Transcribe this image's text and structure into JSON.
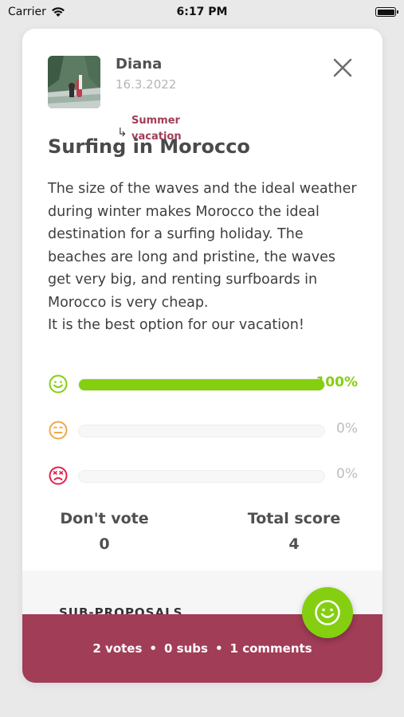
{
  "status_bar": {
    "carrier": "Carrier",
    "time": "6:17 PM"
  },
  "proposal": {
    "author": "Diana",
    "date": "16.3.2022",
    "parent_label": "Summer vacation",
    "title": "Surfing in Morocco",
    "body": "The size of the waves and the ideal weather during winter makes Morocco the ideal destination for a surfing holiday. The beaches are long and pristine, the waves get very big, and renting surfboards in Morocco is very cheap.\nIt is the best option for our vacation!"
  },
  "votes": [
    {
      "icon": "smile-icon",
      "percent_label": "100%",
      "fraction": 1.0,
      "color": "#84cf0f"
    },
    {
      "icon": "neutral-face-icon",
      "percent_label": "0%",
      "fraction": 0.0,
      "color": "#f0a847"
    },
    {
      "icon": "angry-face-icon",
      "percent_label": "0%",
      "fraction": 0.0,
      "color": "#e0234a"
    }
  ],
  "stats": {
    "dont_vote_label": "Don't vote",
    "dont_vote_value": "0",
    "total_score_label": "Total score",
    "total_score_value": "4"
  },
  "sub_proposals_heading": "SUB-PROPOSALS",
  "footer": {
    "votes": "2 votes",
    "subs": "0 subs",
    "comments": "1 comments"
  },
  "colors": {
    "accent_green": "#84cf0f",
    "brand": "#a13d57"
  }
}
